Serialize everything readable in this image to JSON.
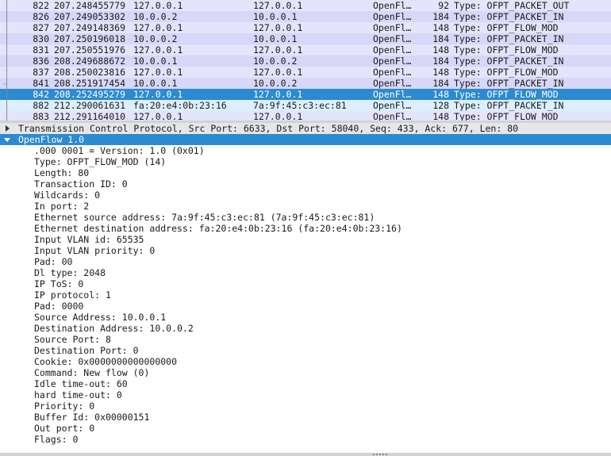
{
  "packet_list": {
    "rows": [
      {
        "no": "822",
        "time": "207.248455779",
        "source": "127.0.0.1",
        "destination": "127.0.0.1",
        "protocol": "OpenFl…",
        "length": "92",
        "info": "Type: OFPT_PACKET_OUT",
        "style": "even"
      },
      {
        "no": "826",
        "time": "207.249053302",
        "source": "10.0.0.2",
        "destination": "10.0.0.1",
        "protocol": "OpenFl…",
        "length": "184",
        "info": "Type: OFPT_PACKET_IN",
        "style": "odd"
      },
      {
        "no": "827",
        "time": "207.249148369",
        "source": "127.0.0.1",
        "destination": "127.0.0.1",
        "protocol": "OpenFl…",
        "length": "148",
        "info": "Type: OFPT_FLOW_MOD",
        "style": "even"
      },
      {
        "no": "830",
        "time": "207.250196018",
        "source": "10.0.0.2",
        "destination": "10.0.0.1",
        "protocol": "OpenFl…",
        "length": "184",
        "info": "Type: OFPT_PACKET_IN",
        "style": "odd"
      },
      {
        "no": "831",
        "time": "207.250551976",
        "source": "127.0.0.1",
        "destination": "127.0.0.1",
        "protocol": "OpenFl…",
        "length": "148",
        "info": "Type: OFPT_FLOW_MOD",
        "style": "even"
      },
      {
        "no": "836",
        "time": "208.249688672",
        "source": "10.0.0.1",
        "destination": "10.0.0.2",
        "protocol": "OpenFl…",
        "length": "184",
        "info": "Type: OFPT_PACKET_IN",
        "style": "odd"
      },
      {
        "no": "837",
        "time": "208.250023816",
        "source": "127.0.0.1",
        "destination": "127.0.0.1",
        "protocol": "OpenFl…",
        "length": "148",
        "info": "Type: OFPT_FLOW_MOD",
        "style": "even"
      },
      {
        "no": "841",
        "time": "208.251917454",
        "source": "10.0.0.1",
        "destination": "10.0.0.2",
        "protocol": "OpenFl…",
        "length": "184",
        "info": "Type: OFPT_PACKET_IN",
        "style": "odd"
      },
      {
        "no": "842",
        "time": "208.252495279",
        "source": "127.0.0.1",
        "destination": "127.0.0.1",
        "protocol": "OpenFl…",
        "length": "148",
        "info": "Type: OFPT_FLOW_MOD",
        "style": "selected"
      },
      {
        "no": "882",
        "time": "212.290061631",
        "source": "fa:20:e4:0b:23:16",
        "destination": "7a:9f:45:c3:ec:81",
        "protocol": "OpenFl…",
        "length": "128",
        "info": "Type: OFPT_PACKET_IN",
        "style": "ip"
      },
      {
        "no": "883",
        "time": "212.291164010",
        "source": "127.0.0.1",
        "destination": "127.0.0.1",
        "protocol": "OpenFl…",
        "length": "148",
        "info": "Type: OFPT_FLOW_MOD",
        "style": "even"
      }
    ]
  },
  "details": {
    "tcp_header": "Transmission Control Protocol, Src Port: 6633, Dst Port: 58040, Seq: 433, Ack: 677, Len: 80",
    "openflow_header": "OpenFlow 1.0",
    "fields": [
      ".000 0001 = Version: 1.0 (0x01)",
      "Type: OFPT_FLOW_MOD (14)",
      "Length: 80",
      "Transaction ID: 0",
      "Wildcards: 0",
      "In port: 2",
      "Ethernet source address: 7a:9f:45:c3:ec:81 (7a:9f:45:c3:ec:81)",
      "Ethernet destination address: fa:20:e4:0b:23:16 (fa:20:e4:0b:23:16)",
      "Input VLAN id: 65535",
      "Input VLAN priority: 0",
      "Pad: 00",
      "Dl type: 2048",
      "IP ToS: 0",
      "IP protocol: 1",
      "Pad: 0000",
      "Source Address: 10.0.0.1",
      "Destination Address: 10.0.0.2",
      "Source Port: 8",
      "Destination Port: 0",
      "Cookie: 0x0000000000000000",
      "Command: New flow (0)",
      "Idle time-out: 60",
      "hard time-out: 0",
      "Priority: 0",
      "Buffer Id: 0x00000151",
      "Out port: 0",
      "Flags: 0"
    ]
  },
  "colors": {
    "row_even": "#e4e4fc",
    "row_odd": "#d7d7f9",
    "selected": "#2c8ad1",
    "selected_text": "#ffffff"
  }
}
